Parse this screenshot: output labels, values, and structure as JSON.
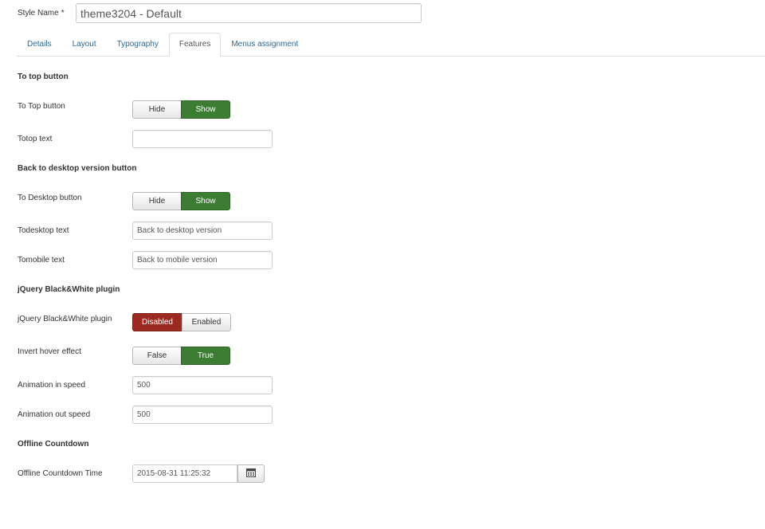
{
  "style_name": {
    "label": "Style Name",
    "required_mark": "*",
    "value": "theme3204 - Default"
  },
  "tabs": [
    {
      "label": "Details",
      "active": false
    },
    {
      "label": "Layout",
      "active": false
    },
    {
      "label": "Typography",
      "active": false
    },
    {
      "label": "Features",
      "active": true
    },
    {
      "label": "Menus assignment",
      "active": false
    }
  ],
  "sections": {
    "to_top": {
      "title": "To top button",
      "button_label": "To Top button",
      "button_options": [
        "Hide",
        "Show"
      ],
      "button_selected": "Show",
      "text_label": "Totop text",
      "text_value": ""
    },
    "to_desktop": {
      "title": "Back to desktop version button",
      "button_label": "To Desktop button",
      "button_options": [
        "Hide",
        "Show"
      ],
      "button_selected": "Show",
      "todesktop_label": "Todesktop text",
      "todesktop_value": "Back to desktop version",
      "tomobile_label": "Tomobile text",
      "tomobile_value": "Back to mobile version"
    },
    "bw_plugin": {
      "title": "jQuery Black&White plugin",
      "plugin_label": "jQuery Black&White plugin",
      "plugin_options": [
        "Disabled",
        "Enabled"
      ],
      "plugin_selected": "Disabled",
      "invert_label": "Invert hover effect",
      "invert_options": [
        "False",
        "True"
      ],
      "invert_selected": "True",
      "speed_in_label": "Animation in speed",
      "speed_in_value": "500",
      "speed_out_label": "Animation out speed",
      "speed_out_value": "500"
    },
    "offline": {
      "title": "Offline Countdown",
      "time_label": "Offline Countdown Time",
      "time_value": "2015-08-31 11:25:32",
      "calendar_icon": "calendar-icon"
    }
  },
  "colors": {
    "selected_green": "#3c7d33",
    "selected_red": "#9c2a23",
    "tab_link": "#2b6a9b"
  }
}
